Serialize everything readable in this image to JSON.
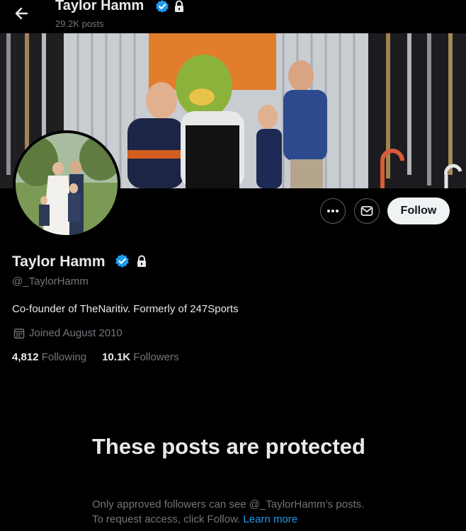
{
  "header": {
    "name": "Taylor Hamm",
    "post_count": "29.2K posts"
  },
  "profile": {
    "name": "Taylor Hamm",
    "handle": "@_TaylorHamm",
    "bio": "Co-founder of TheNaritiv. Formerly of 247Sports",
    "joined": "Joined August 2010",
    "following_count": "4,812",
    "following_label": "Following",
    "followers_count": "10.1K",
    "followers_label": "Followers",
    "verified": true,
    "protected": true
  },
  "actions": {
    "follow_label": "Follow",
    "more_icon": "more-icon",
    "message_icon": "envelope-icon"
  },
  "protected_notice": {
    "title": "These posts are protected",
    "body": "Only approved followers can see @_TaylorHamm’s posts. To request access, click Follow.",
    "link": "Learn more"
  },
  "colors": {
    "background": "#000000",
    "primary_text": "#e7e9ea",
    "secondary_text": "#71767b",
    "verified_blue": "#1d9bf0",
    "follow_button": "#eff3f4"
  }
}
